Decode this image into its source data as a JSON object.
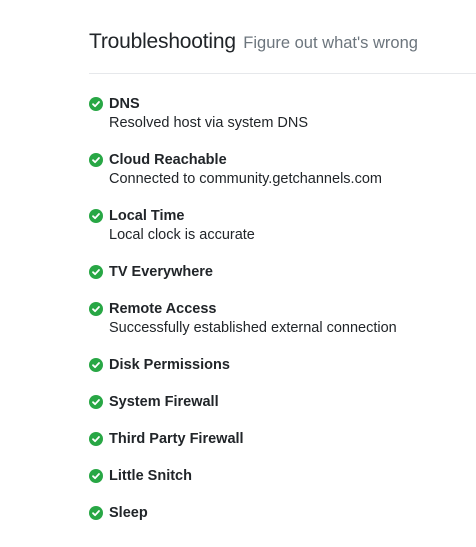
{
  "header": {
    "title": "Troubleshooting",
    "subtitle": "Figure out what's wrong"
  },
  "colors": {
    "success": "#28a745",
    "subtitle": "#6c757d"
  },
  "checks": [
    {
      "name": "DNS",
      "description": "Resolved host via system DNS",
      "status": "check-circle-icon"
    },
    {
      "name": "Cloud Reachable",
      "description": "Connected to community.getchannels.com",
      "status": "check-circle-icon"
    },
    {
      "name": "Local Time",
      "description": "Local clock is accurate",
      "status": "check-circle-icon"
    },
    {
      "name": "TV Everywhere",
      "description": "",
      "status": "check-circle-icon"
    },
    {
      "name": "Remote Access",
      "description": "Successfully established external connection",
      "status": "check-circle-icon"
    },
    {
      "name": "Disk Permissions",
      "description": "",
      "status": "check-circle-icon"
    },
    {
      "name": "System Firewall",
      "description": "",
      "status": "check-circle-icon"
    },
    {
      "name": "Third Party Firewall",
      "description": "",
      "status": "check-circle-icon"
    },
    {
      "name": "Little Snitch",
      "description": "",
      "status": "check-circle-icon"
    },
    {
      "name": "Sleep",
      "description": "",
      "status": "check-circle-icon"
    }
  ]
}
